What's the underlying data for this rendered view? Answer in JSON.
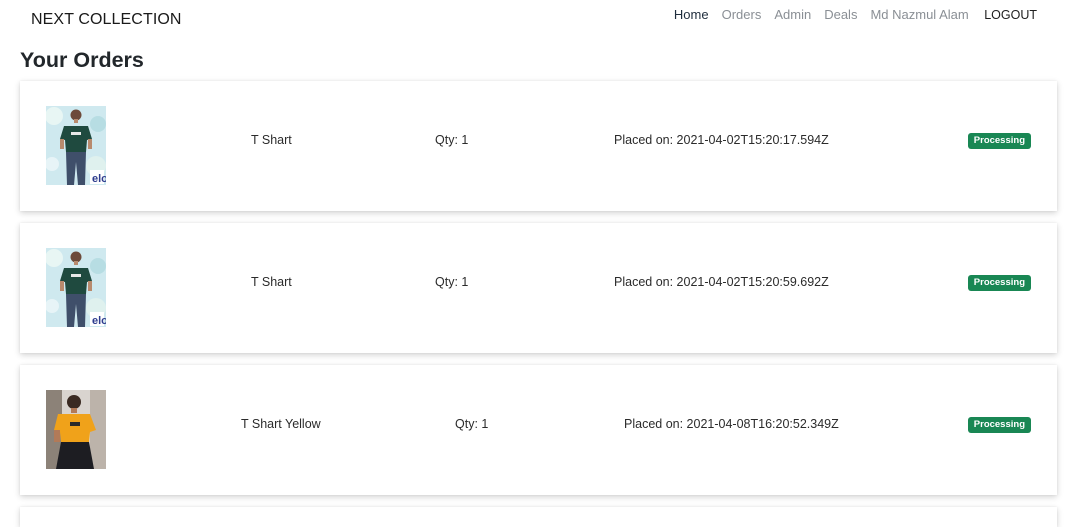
{
  "navbar": {
    "brand": "NEXT COLLECTION",
    "links": [
      {
        "label": "Home",
        "active": true
      },
      {
        "label": "Orders",
        "active": false
      },
      {
        "label": "Admin",
        "active": false
      },
      {
        "label": "Deals",
        "active": false
      },
      {
        "label": "Md Nazmul Alam",
        "active": false
      }
    ],
    "logout_label": "LOGOUT"
  },
  "page": {
    "title": "Your Orders"
  },
  "orders": [
    {
      "product_name": "T Shart",
      "quantity": "Qty: 1",
      "placed_on": "Placed on: 2021-04-02T15:20:17.594Z",
      "status": "Processing",
      "image_icon": "green-tshirt-product-image"
    },
    {
      "product_name": "T Shart",
      "quantity": "Qty: 1",
      "placed_on": "Placed on: 2021-04-02T15:20:59.692Z",
      "status": "Processing",
      "image_icon": "green-tshirt-product-image"
    },
    {
      "product_name": "T Shart Yellow",
      "quantity": "Qty: 1",
      "placed_on": "Placed on: 2021-04-08T16:20:52.349Z",
      "status": "Processing",
      "image_icon": "yellow-tshirt-product-image"
    }
  ],
  "colors": {
    "status_badge": "#198754"
  }
}
